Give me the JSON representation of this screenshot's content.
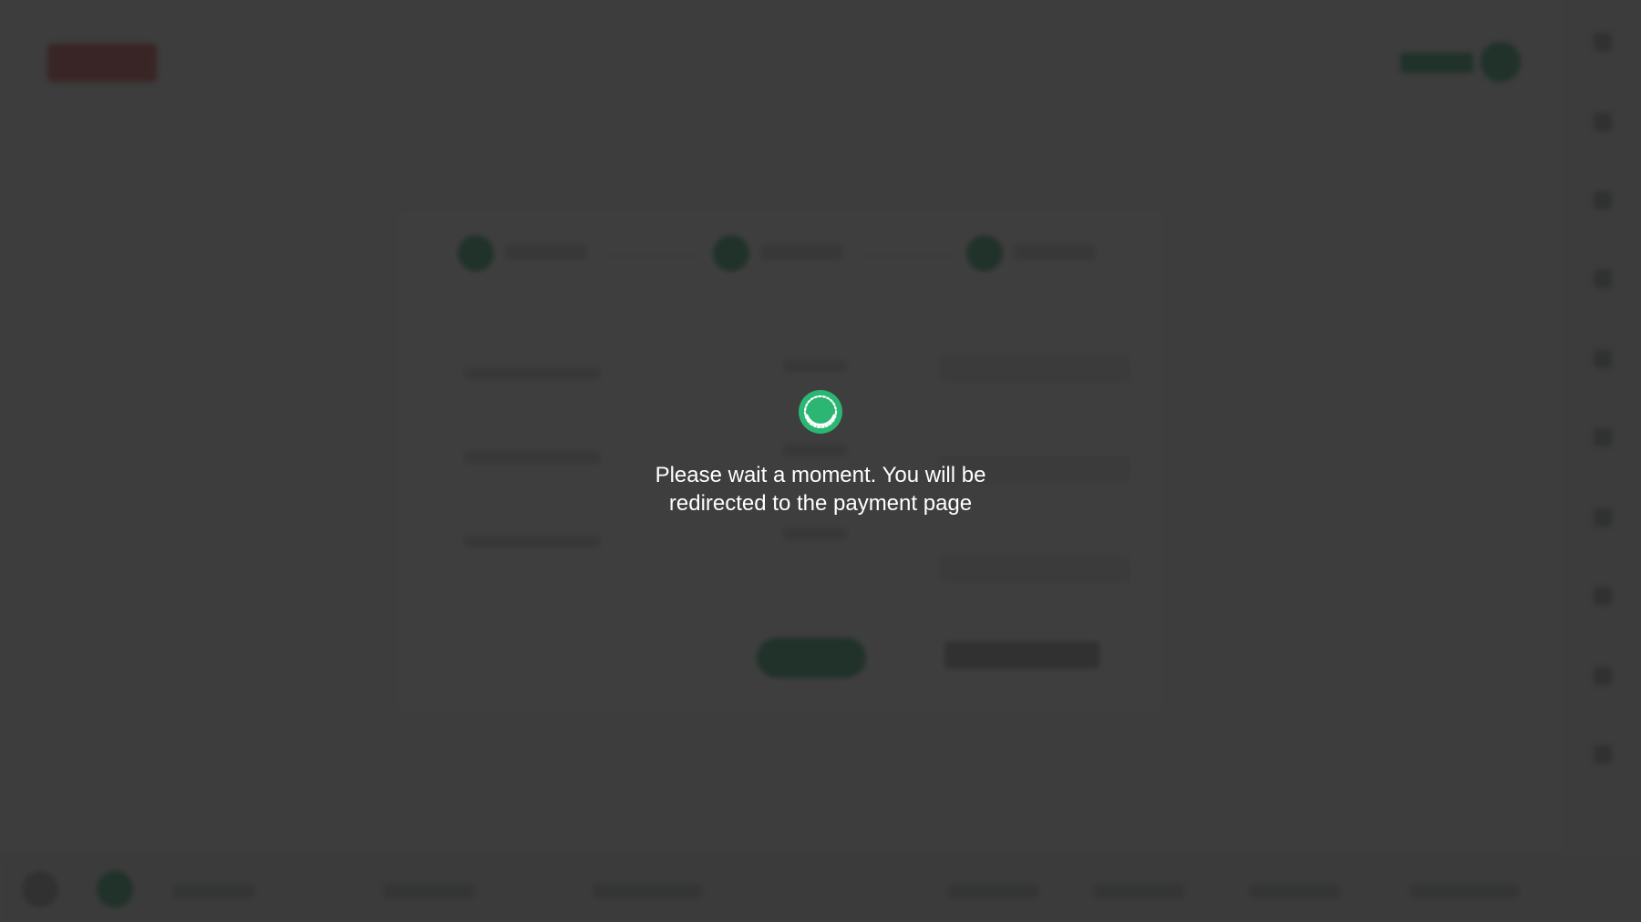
{
  "overlay": {
    "message": "Please wait a moment. You will be\nredirected to the payment page",
    "spinner_icon": "loading-spinner-icon",
    "accent_color": "#2bb673",
    "backdrop_color": "#1e1e1e"
  }
}
